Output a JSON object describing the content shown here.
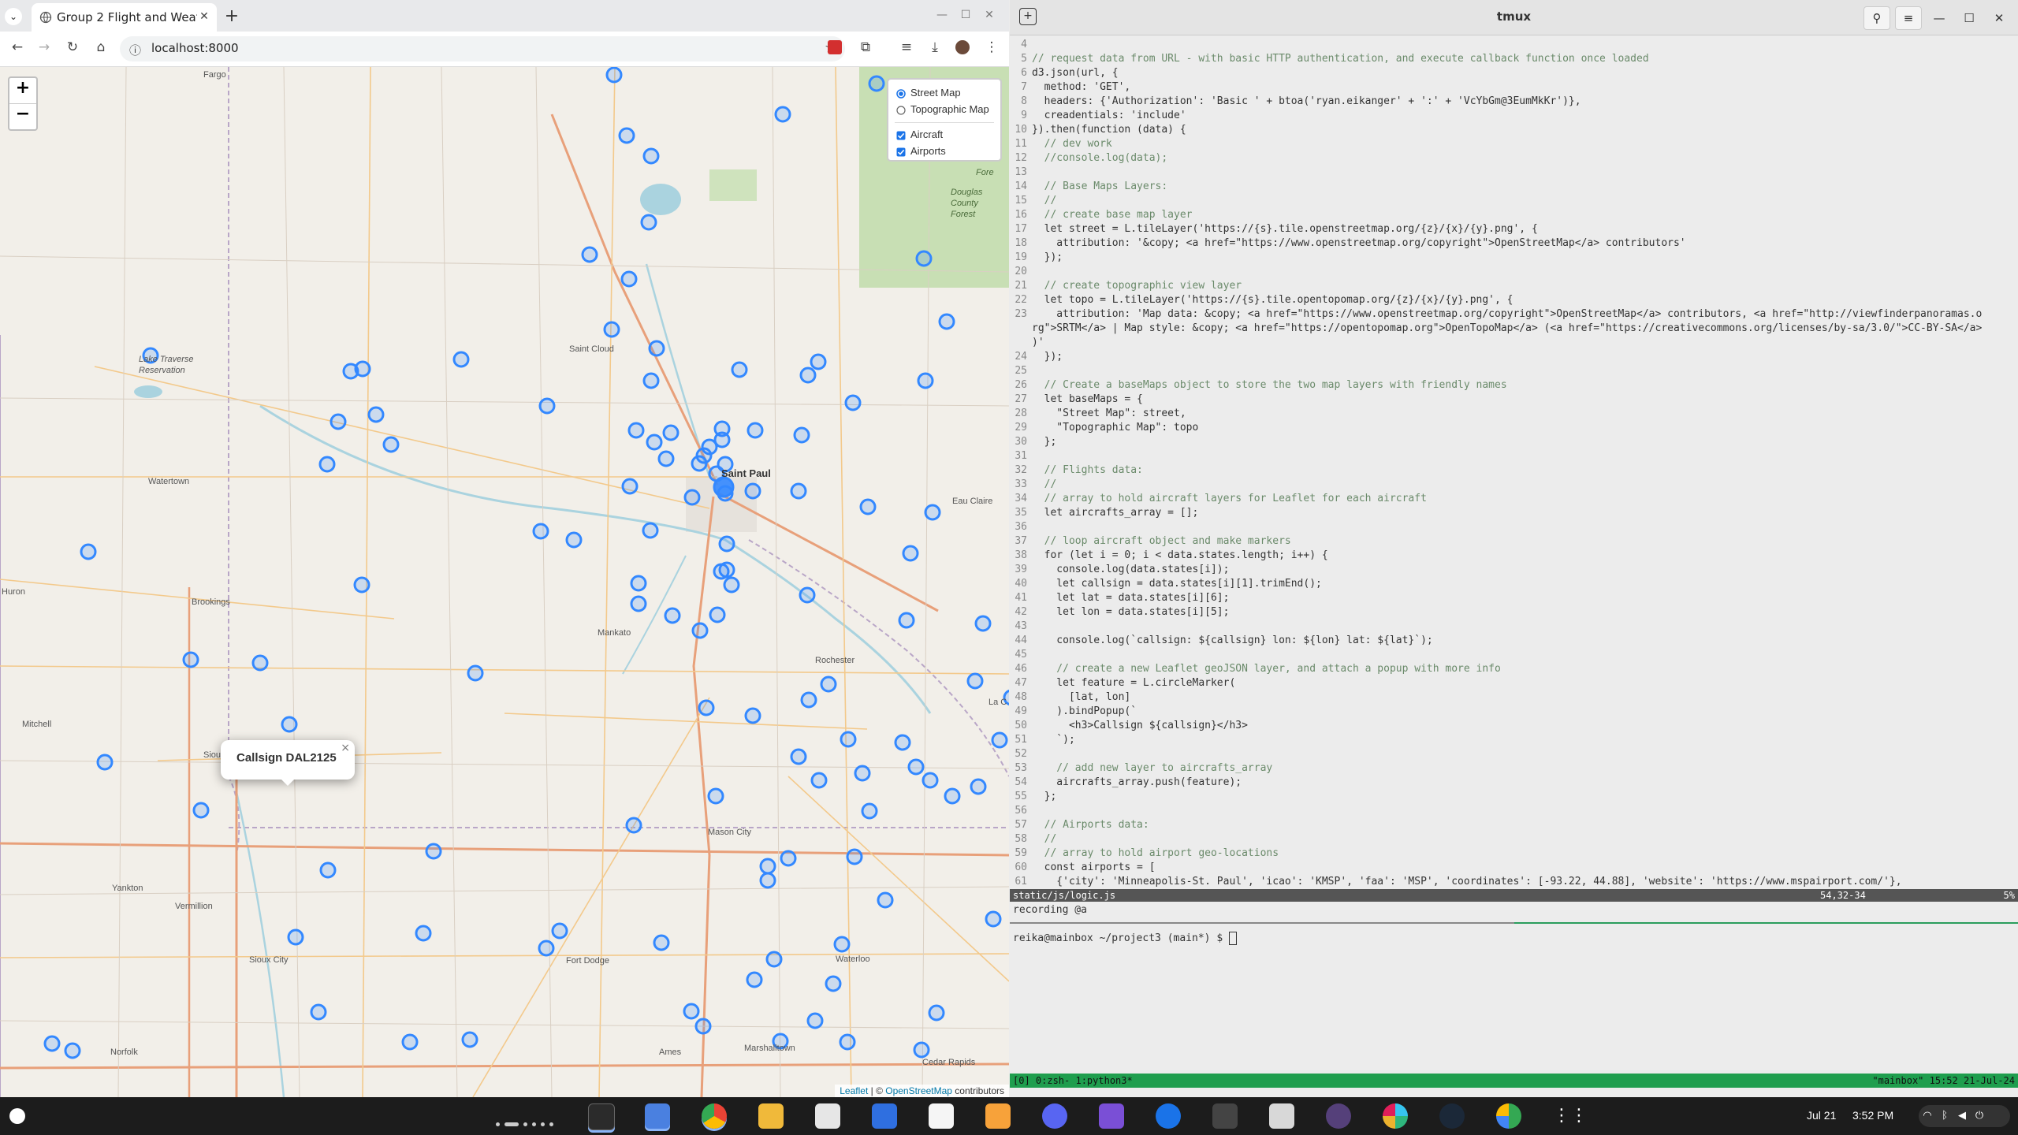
{
  "browser": {
    "tab_title": "Group 2 Flight and Weat",
    "url": "localhost:8000"
  },
  "map": {
    "zoom_in": "+",
    "zoom_out": "−",
    "layers": {
      "street": "Street Map",
      "topo": "Topographic Map",
      "aircraft": "Aircraft",
      "airports": "Airports",
      "street_checked": true,
      "aircraft_checked": true,
      "airports_checked": true
    },
    "popup": {
      "text": "Callsign DAL2125",
      "close": "×"
    },
    "attribution": {
      "leaflet": "Leaflet",
      "sep": " | © ",
      "osm": "OpenStreetMap",
      "suffix": " contributors"
    },
    "place_labels": [
      {
        "name": "Fargo"
      },
      {
        "name": "Saint Cloud"
      },
      {
        "name": "Saint Paul",
        "major": true
      },
      {
        "name": "Watertown"
      },
      {
        "name": "Brookings"
      },
      {
        "name": "Huron"
      },
      {
        "name": "Mankato"
      },
      {
        "name": "Rochester"
      },
      {
        "name": "Eau Claire"
      },
      {
        "name": "Mitchell"
      },
      {
        "name": "Sioux Falls"
      },
      {
        "name": "Yankton"
      },
      {
        "name": "Vermillion"
      },
      {
        "name": "Sioux City"
      },
      {
        "name": "Fort Dodge"
      },
      {
        "name": "Mason City"
      },
      {
        "name": "Waterloo"
      },
      {
        "name": "Ames"
      },
      {
        "name": "Marshalltown"
      },
      {
        "name": "Cedar Rapids"
      },
      {
        "name": "Norfolk"
      },
      {
        "name": "Lake Traverse Reservation"
      },
      {
        "name": "Douglas County Forest"
      },
      {
        "name": "La C"
      },
      {
        "name": "Fore"
      }
    ],
    "aircraft_count": 131,
    "marker_color": "#3388ff"
  },
  "terminal": {
    "title": "tmux",
    "code_lines": [
      {
        "n": "4",
        "t": ""
      },
      {
        "n": "5",
        "t": "// request data from URL - with basic HTTP authentication, and execute callback function once loaded"
      },
      {
        "n": "6",
        "t": "d3.json(url, {"
      },
      {
        "n": "7",
        "t": "  method: 'GET',"
      },
      {
        "n": "8",
        "t": "  headers: {'Authorization': 'Basic ' + btoa('ryan.eikanger' + ':' + 'VcYbGm@3EumMkKr')},"
      },
      {
        "n": "9",
        "t": "  creadentials: 'include'"
      },
      {
        "n": "10",
        "t": "}).then(function (data) {"
      },
      {
        "n": "11",
        "t": "  // dev work"
      },
      {
        "n": "12",
        "t": "  //console.log(data);"
      },
      {
        "n": "13",
        "t": ""
      },
      {
        "n": "14",
        "t": "  // Base Maps Layers:"
      },
      {
        "n": "15",
        "t": "  //"
      },
      {
        "n": "16",
        "t": "  // create base map layer"
      },
      {
        "n": "17",
        "t": "  let street = L.tileLayer('https://{s}.tile.openstreetmap.org/{z}/{x}/{y}.png', {"
      },
      {
        "n": "18",
        "t": "    attribution: '&copy; <a href=\"https://www.openstreetmap.org/copyright\">OpenStreetMap</a> contributors'"
      },
      {
        "n": "19",
        "t": "  });"
      },
      {
        "n": "20",
        "t": ""
      },
      {
        "n": "21",
        "t": "  // create topographic view layer"
      },
      {
        "n": "22",
        "t": "  let topo = L.tileLayer('https://{s}.tile.opentopomap.org/{z}/{x}/{y}.png', {"
      },
      {
        "n": "23",
        "t": "    attribution: 'Map data: &copy; <a href=\"https://www.openstreetmap.org/copyright\">OpenStreetMap</a> contributors, <a href=\"http://viewfinderpanoramas.o"
      },
      {
        "n": "",
        "t": "rg\">SRTM</a> | Map style: &copy; <a href=\"https://opentopomap.org\">OpenTopoMap</a> (<a href=\"https://creativecommons.org/licenses/by-sa/3.0/\">CC-BY-SA</a>"
      },
      {
        "n": "",
        "t": ")'"
      },
      {
        "n": "24",
        "t": "  });"
      },
      {
        "n": "25",
        "t": ""
      },
      {
        "n": "26",
        "t": "  // Create a baseMaps object to store the two map layers with friendly names"
      },
      {
        "n": "27",
        "t": "  let baseMaps = {"
      },
      {
        "n": "28",
        "t": "    \"Street Map\": street,"
      },
      {
        "n": "29",
        "t": "    \"Topographic Map\": topo"
      },
      {
        "n": "30",
        "t": "  };"
      },
      {
        "n": "31",
        "t": ""
      },
      {
        "n": "32",
        "t": "  // Flights data:"
      },
      {
        "n": "33",
        "t": "  //"
      },
      {
        "n": "34",
        "t": "  // array to hold aircraft layers for Leaflet for each aircraft"
      },
      {
        "n": "35",
        "t": "  let aircrafts_array = [];"
      },
      {
        "n": "36",
        "t": ""
      },
      {
        "n": "37",
        "t": "  // loop aircraft object and make markers"
      },
      {
        "n": "38",
        "t": "  for (let i = 0; i < data.states.length; i++) {"
      },
      {
        "n": "39",
        "t": "    console.log(data.states[i]);"
      },
      {
        "n": "40",
        "t": "    let callsign = data.states[i][1].trimEnd();"
      },
      {
        "n": "41",
        "t": "    let lat = data.states[i][6];"
      },
      {
        "n": "42",
        "t": "    let lon = data.states[i][5];"
      },
      {
        "n": "43",
        "t": ""
      },
      {
        "n": "44",
        "t": "    console.log(`callsign: ${callsign} lon: ${lon} lat: ${lat}`);"
      },
      {
        "n": "45",
        "t": ""
      },
      {
        "n": "46",
        "t": "    // create a new Leaflet geoJSON layer, and attach a popup with more info"
      },
      {
        "n": "47",
        "t": "    let feature = L.circleMarker("
      },
      {
        "n": "48",
        "t": "      [lat, lon]"
      },
      {
        "n": "49",
        "t": "    ).bindPopup(`"
      },
      {
        "n": "50",
        "t": "      <h3>Callsign ${callsign}</h3>"
      },
      {
        "n": "51",
        "t": "    `);"
      },
      {
        "n": "52",
        "t": ""
      },
      {
        "n": "53",
        "t": "    // add new layer to aircrafts_array"
      },
      {
        "n": "54",
        "t": "    aircrafts_array.push(feature);"
      },
      {
        "n": "55",
        "t": "  };"
      },
      {
        "n": "56",
        "t": ""
      },
      {
        "n": "57",
        "t": "  // Airports data:"
      },
      {
        "n": "58",
        "t": "  //"
      },
      {
        "n": "59",
        "t": "  // array to hold airport geo-locations"
      },
      {
        "n": "60",
        "t": "  const airports = ["
      },
      {
        "n": "61",
        "t": "    {'city': 'Minneapolis-St. Paul', 'icao': 'KMSP', 'faa': 'MSP', 'coordinates': [-93.22, 44.88], 'website': 'https://www.mspairport.com/'},"
      }
    ],
    "status_file": "static/js/logic.js",
    "status_pos": "54,32-34",
    "status_pct": "5%",
    "recording": "recording @a",
    "prompt_user": "reika@mainbox",
    "prompt_path": "~/project3",
    "prompt_branch": "(main*)",
    "prompt_symbol": "$",
    "tmux_left": "[0] 0:zsh- 1:python3*",
    "tmux_right": "\"mainbox\" 15:52 21-Jul-24"
  },
  "taskbar": {
    "date": "Jul 21",
    "time": "3:52 PM",
    "apps": [
      "terminal",
      "files",
      "chrome",
      "folder",
      "calendar",
      "email",
      "tasks",
      "notes",
      "discord",
      "obsidian",
      "messages",
      "capture",
      "store",
      "screen-recorder",
      "slack",
      "steam",
      "maps",
      "app-grid"
    ],
    "tray_icons": [
      "wifi-icon",
      "bluetooth-icon",
      "volume-icon",
      "power-icon"
    ]
  }
}
